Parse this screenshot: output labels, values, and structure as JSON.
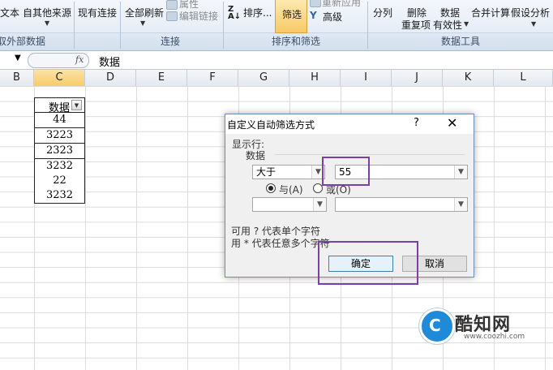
{
  "ribbon": {
    "data_group": {
      "from_text": "文本",
      "from_other": "自其他来源",
      "existing": "现有连接",
      "label": "取外部数据"
    },
    "connections_group": {
      "refresh_all": "全部刷新",
      "properties": "属性",
      "edit_links": "编辑链接",
      "label": "连接"
    },
    "sort_filter_group": {
      "sort": "排序...",
      "filter": "筛选",
      "reapply": "重新应用",
      "advanced": "高级",
      "label": "排序和筛选"
    },
    "data_tools_group": {
      "split": "分列",
      "remove_dup_1": "删除",
      "remove_dup_2": "重复项",
      "validation_1": "数据",
      "validation_2": "有效性",
      "consolidate": "合并计算",
      "what_if": "假设分析",
      "label": "数据工具"
    }
  },
  "formula_bar": {
    "fx": "fx",
    "content": "数据"
  },
  "grid": {
    "columns": [
      "B",
      "C",
      "D",
      "E",
      "F",
      "G",
      "H",
      "I",
      "J",
      "K",
      "L"
    ],
    "active_column": "C",
    "header_cell": "数据",
    "values": [
      "44",
      "3223",
      "2323",
      "3232",
      "22",
      "3232"
    ]
  },
  "dialog": {
    "title": "自定义自动筛选方式",
    "help": "?",
    "close": "✕",
    "show_rows_label": "显示行:",
    "field_label": "数据",
    "condition1_operator": "大于",
    "condition1_value": "55",
    "and_label": "与(A)",
    "or_label": "或(O)",
    "condition2_operator": "",
    "condition2_value": "",
    "hint1": "可用 ? 代表单个字符",
    "hint2": "用 * 代表任意多个字符",
    "ok": "确定",
    "cancel": "取消"
  },
  "watermark": {
    "name": "酷知网",
    "url": "www.coozhi.com"
  },
  "colors": {
    "highlight": "#7b3fa8",
    "accent": "#1f8ad8"
  }
}
